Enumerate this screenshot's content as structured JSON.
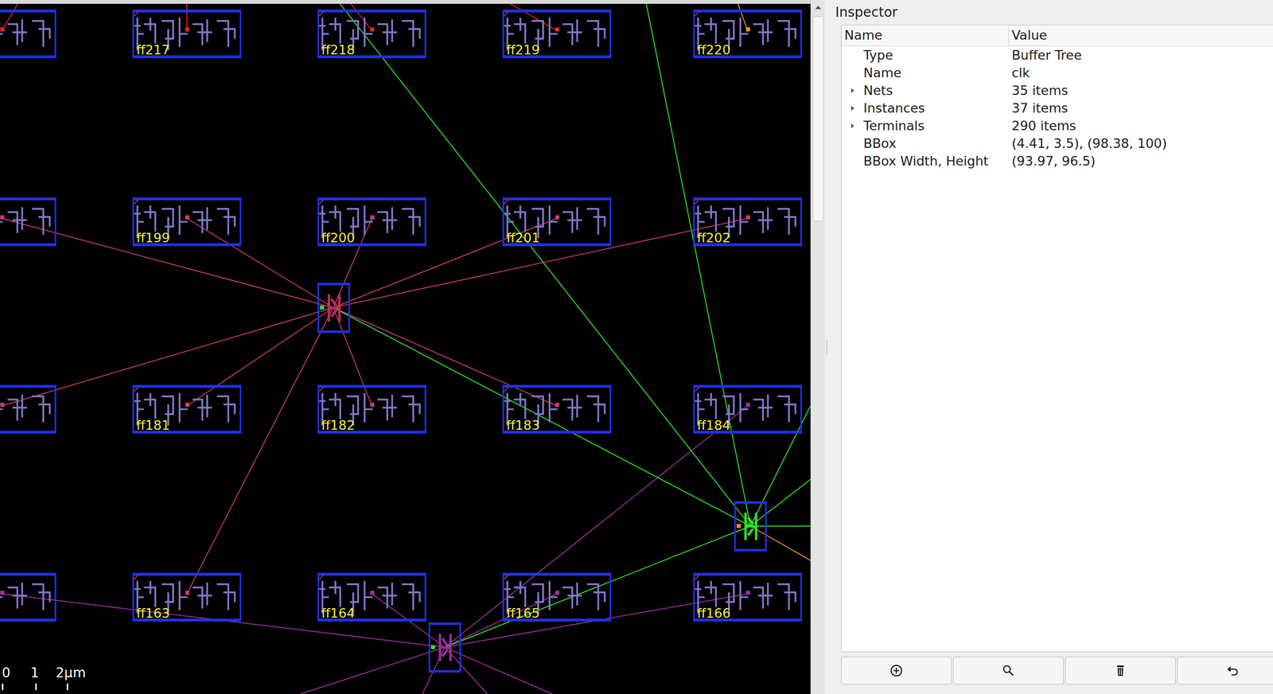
{
  "grid": [
    {
      "cells": [
        {
          "clipped": true,
          "color": "#e02a2a"
        },
        {
          "clipped": false,
          "label": "ff217",
          "color": "#e02a2a"
        },
        {
          "clipped": false,
          "label": "ff218",
          "color": "#e02a2a"
        },
        {
          "clipped": false,
          "label": "ff219",
          "color": "#e02a2a"
        },
        {
          "clipped": false,
          "label": "ff220",
          "color": "#f0901f"
        }
      ]
    },
    {
      "cells": [
        {
          "clipped": true,
          "color": "#c8406a"
        },
        {
          "clipped": false,
          "label": "ff199",
          "color": "#c8406a"
        },
        {
          "clipped": false,
          "label": "ff200",
          "color": "#c8406a"
        },
        {
          "clipped": false,
          "label": "ff201",
          "color": "#c8406a"
        },
        {
          "clipped": false,
          "label": "ff202",
          "color": "#c8406a"
        }
      ]
    },
    {
      "cells": [
        {
          "clipped": true,
          "color": "#c8406a"
        },
        {
          "clipped": false,
          "label": "ff181",
          "color": "#c8406a"
        },
        {
          "clipped": false,
          "label": "ff182",
          "color": "#c8406a"
        },
        {
          "clipped": false,
          "label": "ff183",
          "color": "#c8406a"
        },
        {
          "clipped": false,
          "label": "ff184",
          "color": "#a8309a"
        }
      ]
    },
    {
      "cells": [
        {
          "clipped": true,
          "color": "#a8309a"
        },
        {
          "clipped": false,
          "label": "ff163",
          "color": "#c8406a"
        },
        {
          "clipped": false,
          "label": "ff164",
          "color": "#a8309a"
        },
        {
          "clipped": false,
          "label": "ff165",
          "color": "#a8309a"
        },
        {
          "clipped": false,
          "label": "ff166",
          "color": "#a8309a"
        }
      ]
    }
  ],
  "buffers": [
    {
      "color": "#b8305c",
      "pin_color": "#30e030"
    },
    {
      "color": "#30e030",
      "pin_color": "#f0901f"
    },
    {
      "color": "#9a2c9a",
      "pin_color": "#30e030"
    }
  ],
  "nets": [
    {
      "color": "#c0396a"
    },
    {
      "color": "#9a2c9a"
    },
    {
      "color": "#2ee02e"
    },
    {
      "color": "#e02020"
    },
    {
      "color": "#f0901f"
    }
  ],
  "scale_bar": [
    "0",
    "1",
    "2μm"
  ],
  "inspector": {
    "title": "Inspector",
    "columns": [
      "Name",
      "Value"
    ],
    "rows": [
      {
        "name": "Type",
        "value": "Buffer Tree",
        "expandable": false
      },
      {
        "name": "Name",
        "value": "clk",
        "expandable": false
      },
      {
        "name": "Nets",
        "value": "35 items",
        "expandable": true,
        "expanded": false
      },
      {
        "name": "Instances",
        "value": "37 items",
        "expandable": true,
        "expanded": false
      },
      {
        "name": "Terminals",
        "value": "290 items",
        "expandable": true,
        "expanded": false
      },
      {
        "name": "BBox",
        "value": "(4.41, 3.5), (98.38, 100)",
        "expandable": false
      },
      {
        "name": "BBox Width, Height",
        "value": "(93.97, 96.5)",
        "expandable": false
      }
    ]
  }
}
